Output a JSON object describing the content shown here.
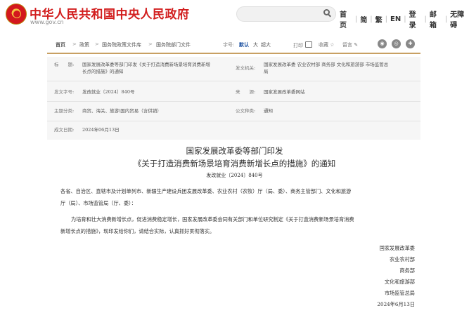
{
  "header": {
    "site_title": "中华人民共和国中央人民政府",
    "site_url": "www.gov.cn",
    "nav": [
      "首页",
      "简",
      "繁",
      "EN",
      "登录",
      "邮箱",
      "无障碍"
    ]
  },
  "breadcrumb": [
    "首页",
    "政策",
    "国务院政策文件库",
    "国务院部门文件"
  ],
  "tools": {
    "font_label": "字号:",
    "font_default": "默认",
    "font_large": "大",
    "font_xlarge": "超大",
    "print": "打印",
    "favorite": "收藏",
    "comment": "留言"
  },
  "info": {
    "title_label": "标　　题:",
    "title_value_1": "国家发展改革委等部门印发《关于打造消费新场景培育消费新增",
    "title_value_2": "长点的措施》的通知",
    "issuer_label": "发文机关:",
    "issuer_value_1": "国家发展改革委 农业农村部 商务部 文化和旅游部 市场监管总",
    "issuer_value_2": "局",
    "docno_label": "发文字号:",
    "docno_value": "发改就业〔2024〕840号",
    "source_label": "来　　源:",
    "source_value": "国家发展改革委网站",
    "topic_label": "主题分类:",
    "topic_value": "商贸、海关、旅游\\国内贸易（含供销）",
    "type_label": "公文种类:",
    "type_value": "通知",
    "date_label": "成文日期:",
    "date_value": "2024年06月13日"
  },
  "document": {
    "heading_1": "国家发展改革委等部门印发",
    "heading_2": "《关于打造消费新场景培育消费新增长点的措施》的通知",
    "doc_number": "发改就业〔2024〕840号",
    "recipients_1": "各省、自治区、直辖市及计划单列市、新疆生产建设兵团发展改革委、农业农村（农牧）厅（局、委）、商务主管部门、文化和旅游",
    "recipients_2": "厅（局）、市场监管局（厅、委）：",
    "para_1": "为培育和壮大消费新增长点，促进消费稳定增长，国家发展改革委会同有关部门和单位研究制定《关于打造消费新场景培育消费",
    "para_2": "新增长点的措施》，现印发给你们，请结合实际，认真抓好贯彻落实。",
    "signatories": [
      "国家发展改革委",
      "农业农村部",
      "商务部",
      "文化和旅游部",
      "市场监管总局",
      "2024年6月13日"
    ]
  }
}
